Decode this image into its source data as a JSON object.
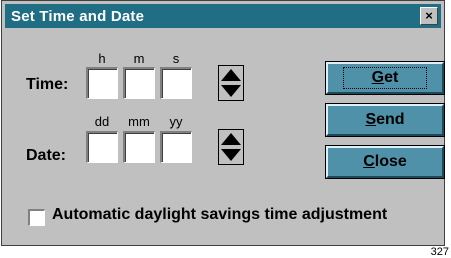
{
  "window": {
    "title": "Set Time and Date",
    "close_glyph": "×"
  },
  "time_row": {
    "label": "Time:",
    "sublabels": [
      "h",
      "m",
      "s"
    ],
    "values": [
      "",
      "",
      ""
    ]
  },
  "date_row": {
    "label": "Date:",
    "sublabels": [
      "dd",
      "mm",
      "yy"
    ],
    "values": [
      "",
      "",
      ""
    ]
  },
  "buttons": {
    "get": "Get",
    "send": "Send",
    "close": "Close"
  },
  "checkbox": {
    "label": "Automatic daylight savings time adjustment",
    "checked": false
  },
  "figure_number": "327",
  "colors": {
    "titlebar": "#1f6e84",
    "button_face": "#4f91a8",
    "dialog_face": "#c0c0c0"
  }
}
